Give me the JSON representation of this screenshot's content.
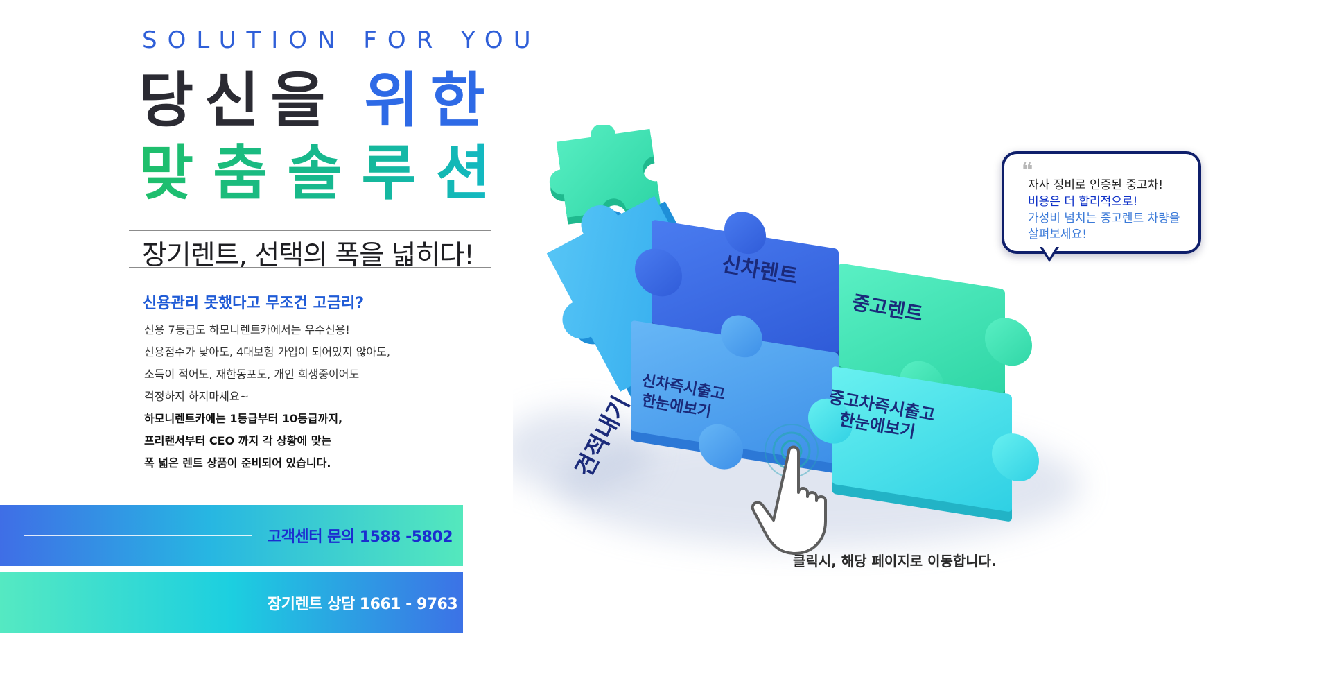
{
  "hero": {
    "eyebrow": "SOLUTION FOR YOU",
    "headline_part1": "당신을",
    "headline_part2": "위한",
    "headline_line2": "맞춤솔루션",
    "subtitle": "장기렌트, 선택의 폭을 넓히다!"
  },
  "info": {
    "question": "신용관리 못했다고 무조건 고금리?",
    "lines": [
      "신용 7등급도 하모니렌트카에서는 우수신용!",
      "신용점수가 낮아도, 4대보험 가입이 되어있지 않아도,",
      "소득이 적어도, 재한동포도, 개인 회생중이어도",
      "걱정하지 하지마세요~"
    ],
    "bold_lines": [
      "하모니렌트카에는 1등급부터 10등급까지,",
      "프리랜서부터 CEO 까지 각 상황에 맞는",
      "폭 넓은 렌트 상품이 준비되어 있습니다."
    ]
  },
  "contacts": {
    "customer_center": "고객센터 문의 1588 -5802",
    "long_term_consult": "장기렌트 상담 1661 - 9763"
  },
  "puzzle": {
    "new_car_rent": "신차렌트",
    "used_car_rent": "중고렌트",
    "new_car_immediate_line1": "신차즉시출고",
    "new_car_immediate_line2": "한눈에보기",
    "used_car_immediate_line1": "중고차즉시출고",
    "used_car_immediate_line2": "한눈에보기",
    "estimate": "견적내기"
  },
  "bubble": {
    "quote_mark": "❝",
    "line1": "자사 정비로 인증된 중고차!",
    "line2": "비용은 더 합리적으로!",
    "line3": "가성비 넘치는 중고렌트 차량을",
    "line4": "살펴보세요!"
  },
  "caption": "클릭시, 해당 페이지로 이동합니다.",
  "colors": {
    "accent_blue": "#2e6ae6",
    "accent_green": "#16b792",
    "piece_blue": "#3d6ee8",
    "piece_teal": "#39e3b3",
    "piece_light_blue": "#4ea7f0",
    "piece_cyan": "#3fd9ea"
  },
  "icons": {
    "hand": "hand-pointer-icon",
    "ripple": "click-ripple-icon"
  }
}
